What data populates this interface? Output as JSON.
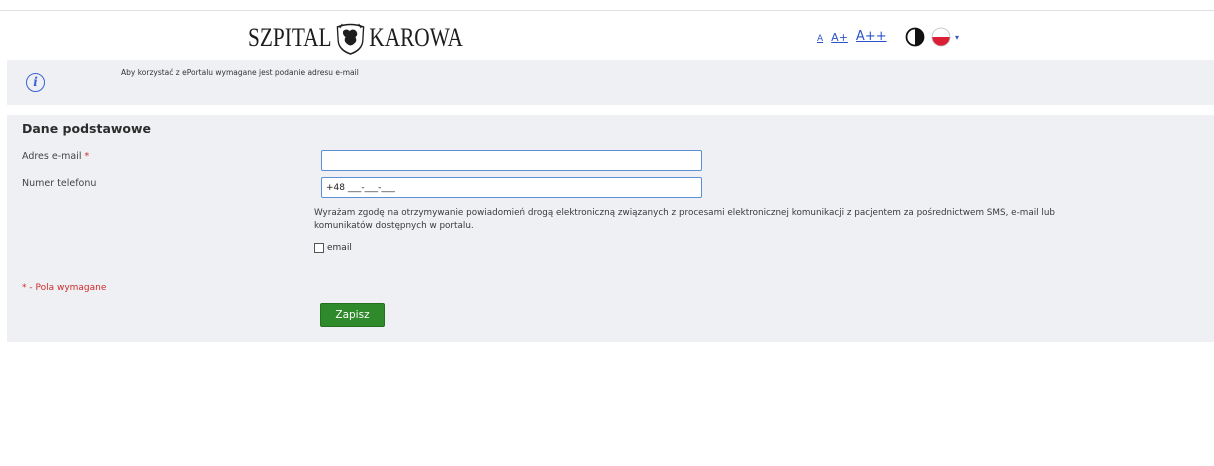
{
  "header": {
    "logo_left": "SZPITAL",
    "logo_right": "KAROWA",
    "font_small": "A",
    "font_medium": "A+",
    "font_large": "A++",
    "contrast_icon": "contrast-icon",
    "language_flag": "poland-flag-icon",
    "language_caret": "▾"
  },
  "info": {
    "icon": "info-icon",
    "icon_glyph": "i",
    "message": "Aby korzystać z ePortalu wymagane jest podanie adresu e-mail"
  },
  "form": {
    "section_title": "Dane podstawowe",
    "email_label": "Adres e-mail",
    "required_mark": "*",
    "email_value": "",
    "phone_label": "Numer telefonu",
    "phone_value": "+48 ___-___-___",
    "consent_text": "Wyrażam zgodę na otrzymywanie powiadomień drogą elektroniczną związanych z procesami elektronicznej komunikacji z pacjentem za pośrednictwem SMS, e-mail lub komunikatów dostępnych w portalu.",
    "checkbox_email_label": "email",
    "checkbox_email_checked": false,
    "required_note": "* - Pola wymagane",
    "save_label": "Zapisz"
  },
  "colors": {
    "accent": "#2b54c8",
    "panel_bg": "#eef0f3",
    "save_button": "#2f8a2c",
    "required": "#d02b2b"
  }
}
